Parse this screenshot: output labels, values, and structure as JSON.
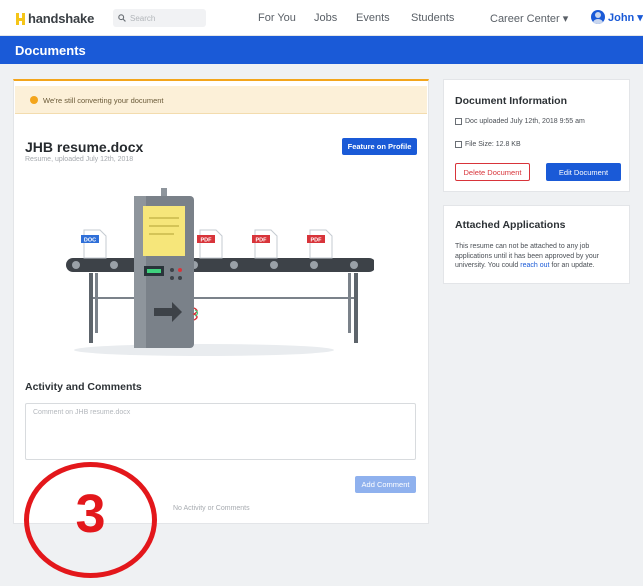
{
  "nav": {
    "logo": "handshake",
    "search_placeholder": "Search",
    "items": [
      "For You",
      "Jobs",
      "Events",
      "Students",
      "Career Center ▾"
    ],
    "user": "John ▾"
  },
  "page_title": "Documents",
  "main": {
    "warning": "We're still converting your document",
    "doc_title": "JHB resume.docx",
    "doc_sub": "Resume, uploaded July 12th, 2018",
    "feature_button": "Feature on Profile",
    "file_labels": [
      "DOC",
      "PDF",
      "PDF",
      "PDF"
    ],
    "activity_title": "Activity and Comments",
    "comment_placeholder": "Comment on JHB resume.docx",
    "add_comment": "Add Comment",
    "no_activity": "No Activity or Comments"
  },
  "info": {
    "title": "Document Information",
    "uploaded": "Doc uploaded July 12th, 2018 9:55 am",
    "size": "File Size: 12.8 KB",
    "delete": "Delete Document",
    "edit": "Edit Document"
  },
  "apps": {
    "title": "Attached Applications",
    "text_before": "This resume can not be attached to any job applications until it has been approved by your university. You could ",
    "link": "reach out",
    "text_after": " for an update."
  },
  "annotation": "3",
  "colors": {
    "brand_blue": "#1a5ad7",
    "warning_orange": "#f3a51c",
    "danger_red": "#d8343a",
    "annotation_red": "#e3171b"
  }
}
